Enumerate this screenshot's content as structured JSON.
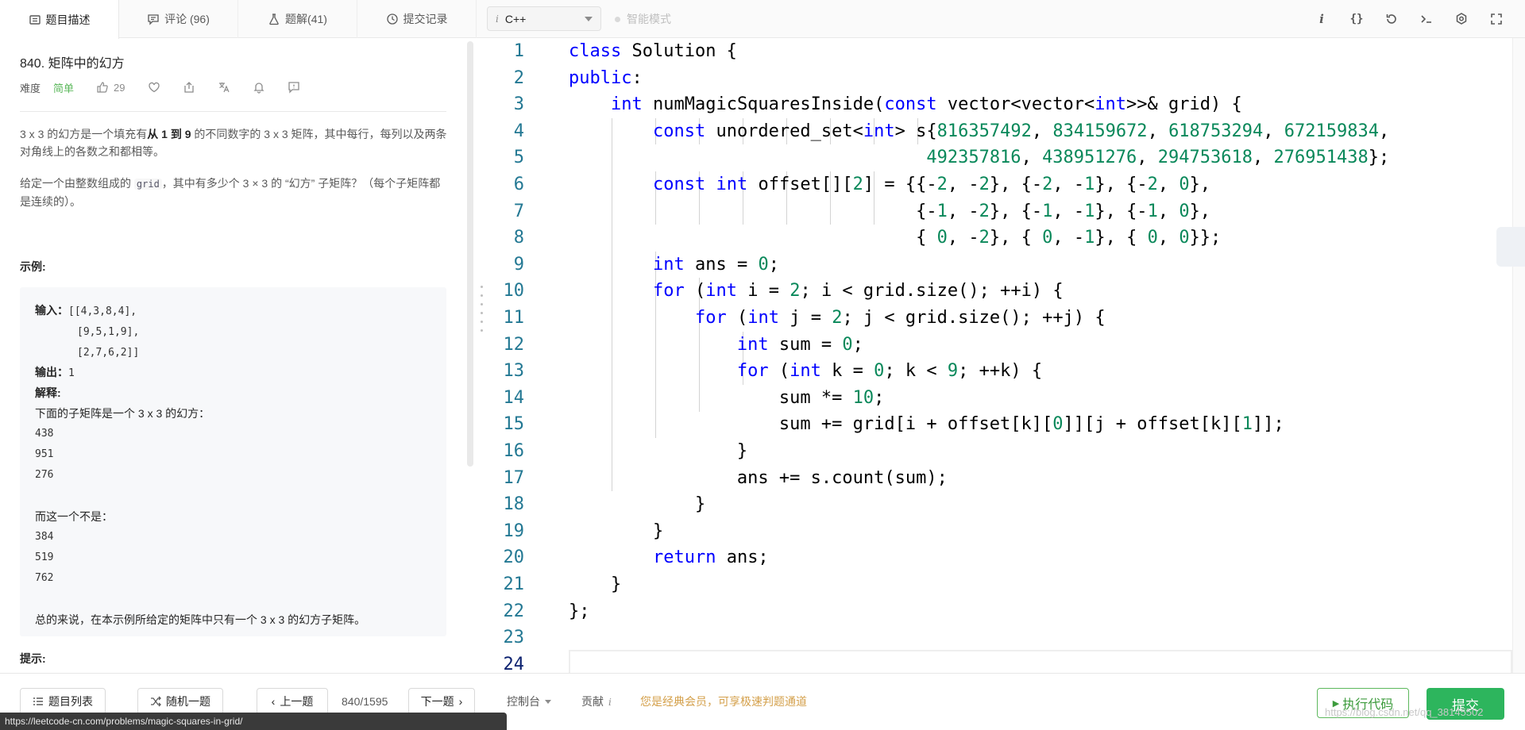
{
  "tabs": [
    {
      "label": "题目描述",
      "icon": "document-icon"
    },
    {
      "label": "评论 (96)",
      "icon": "comment-icon"
    },
    {
      "label": "题解(41)",
      "icon": "flask-icon"
    },
    {
      "label": "提交记录",
      "icon": "clock-icon"
    }
  ],
  "language": {
    "info": "i",
    "selected": "C++"
  },
  "smart_mode": "智能模式",
  "toolbar_icons": [
    "info-icon",
    "braces-icon",
    "reset-icon",
    "terminal-icon",
    "settings-icon",
    "fullscreen-icon"
  ],
  "problem": {
    "title": "840. 矩阵中的幻方",
    "difficulty_label": "难度",
    "difficulty": "简单",
    "likes": "29",
    "desc1_a": "3 x 3 的幻方是一个填充有",
    "desc1_b": "从 1 到 9",
    "desc1_c": " 的不同数字的 3 x 3 矩阵，其中每行，每列以及两条对角线上的各数之和都相等。",
    "desc2_a": "给定一个由整数组成的 ",
    "desc2_code": "grid",
    "desc2_b": "，其中有多少个 3 × 3 的 “幻方” 子矩阵？（每个子矩阵都是连续的）。",
    "example_heading": "示例:",
    "example": {
      "input_label": "输入：",
      "input_lines": [
        "[[4,3,8,4],",
        "[9,5,1,9],",
        "[2,7,6,2]]"
      ],
      "output_label": "输出：",
      "output": "1",
      "explain_label": "解释:",
      "explain_a": "下面的子矩阵是一个 3 x 3 的幻方：",
      "square_a": [
        "438",
        "951",
        "276"
      ],
      "explain_b": "而这一个不是：",
      "square_b": [
        "384",
        "519",
        "762"
      ],
      "summary": "总的来说，在本示例所给定的矩阵中只有一个 3 x 3 的幻方子矩阵。"
    },
    "hint_heading": "提示:"
  },
  "editor": {
    "line_numbers": [
      "1",
      "2",
      "3",
      "4",
      "5",
      "6",
      "7",
      "8",
      "9",
      "10",
      "11",
      "12",
      "13",
      "14",
      "15",
      "16",
      "17",
      "18",
      "19",
      "20",
      "21",
      "22",
      "23",
      "24"
    ],
    "current_line": "24"
  },
  "bottom": {
    "list_btn": "题目列表",
    "random_btn": "随机一题",
    "prev_btn": "上一题",
    "page": "840/1595",
    "next_btn": "下一题",
    "console": "控制台",
    "contribute": "贡献",
    "contribute_icon": "i",
    "vip_note": "您是经典会员，可享极速判题通道",
    "run_btn": "执行代码",
    "submit_btn": "提交"
  },
  "status_url": "https://leetcode-cn.com/problems/magic-squares-in-grid/",
  "watermark": "https://blog.csdn.net/qq_38145502"
}
